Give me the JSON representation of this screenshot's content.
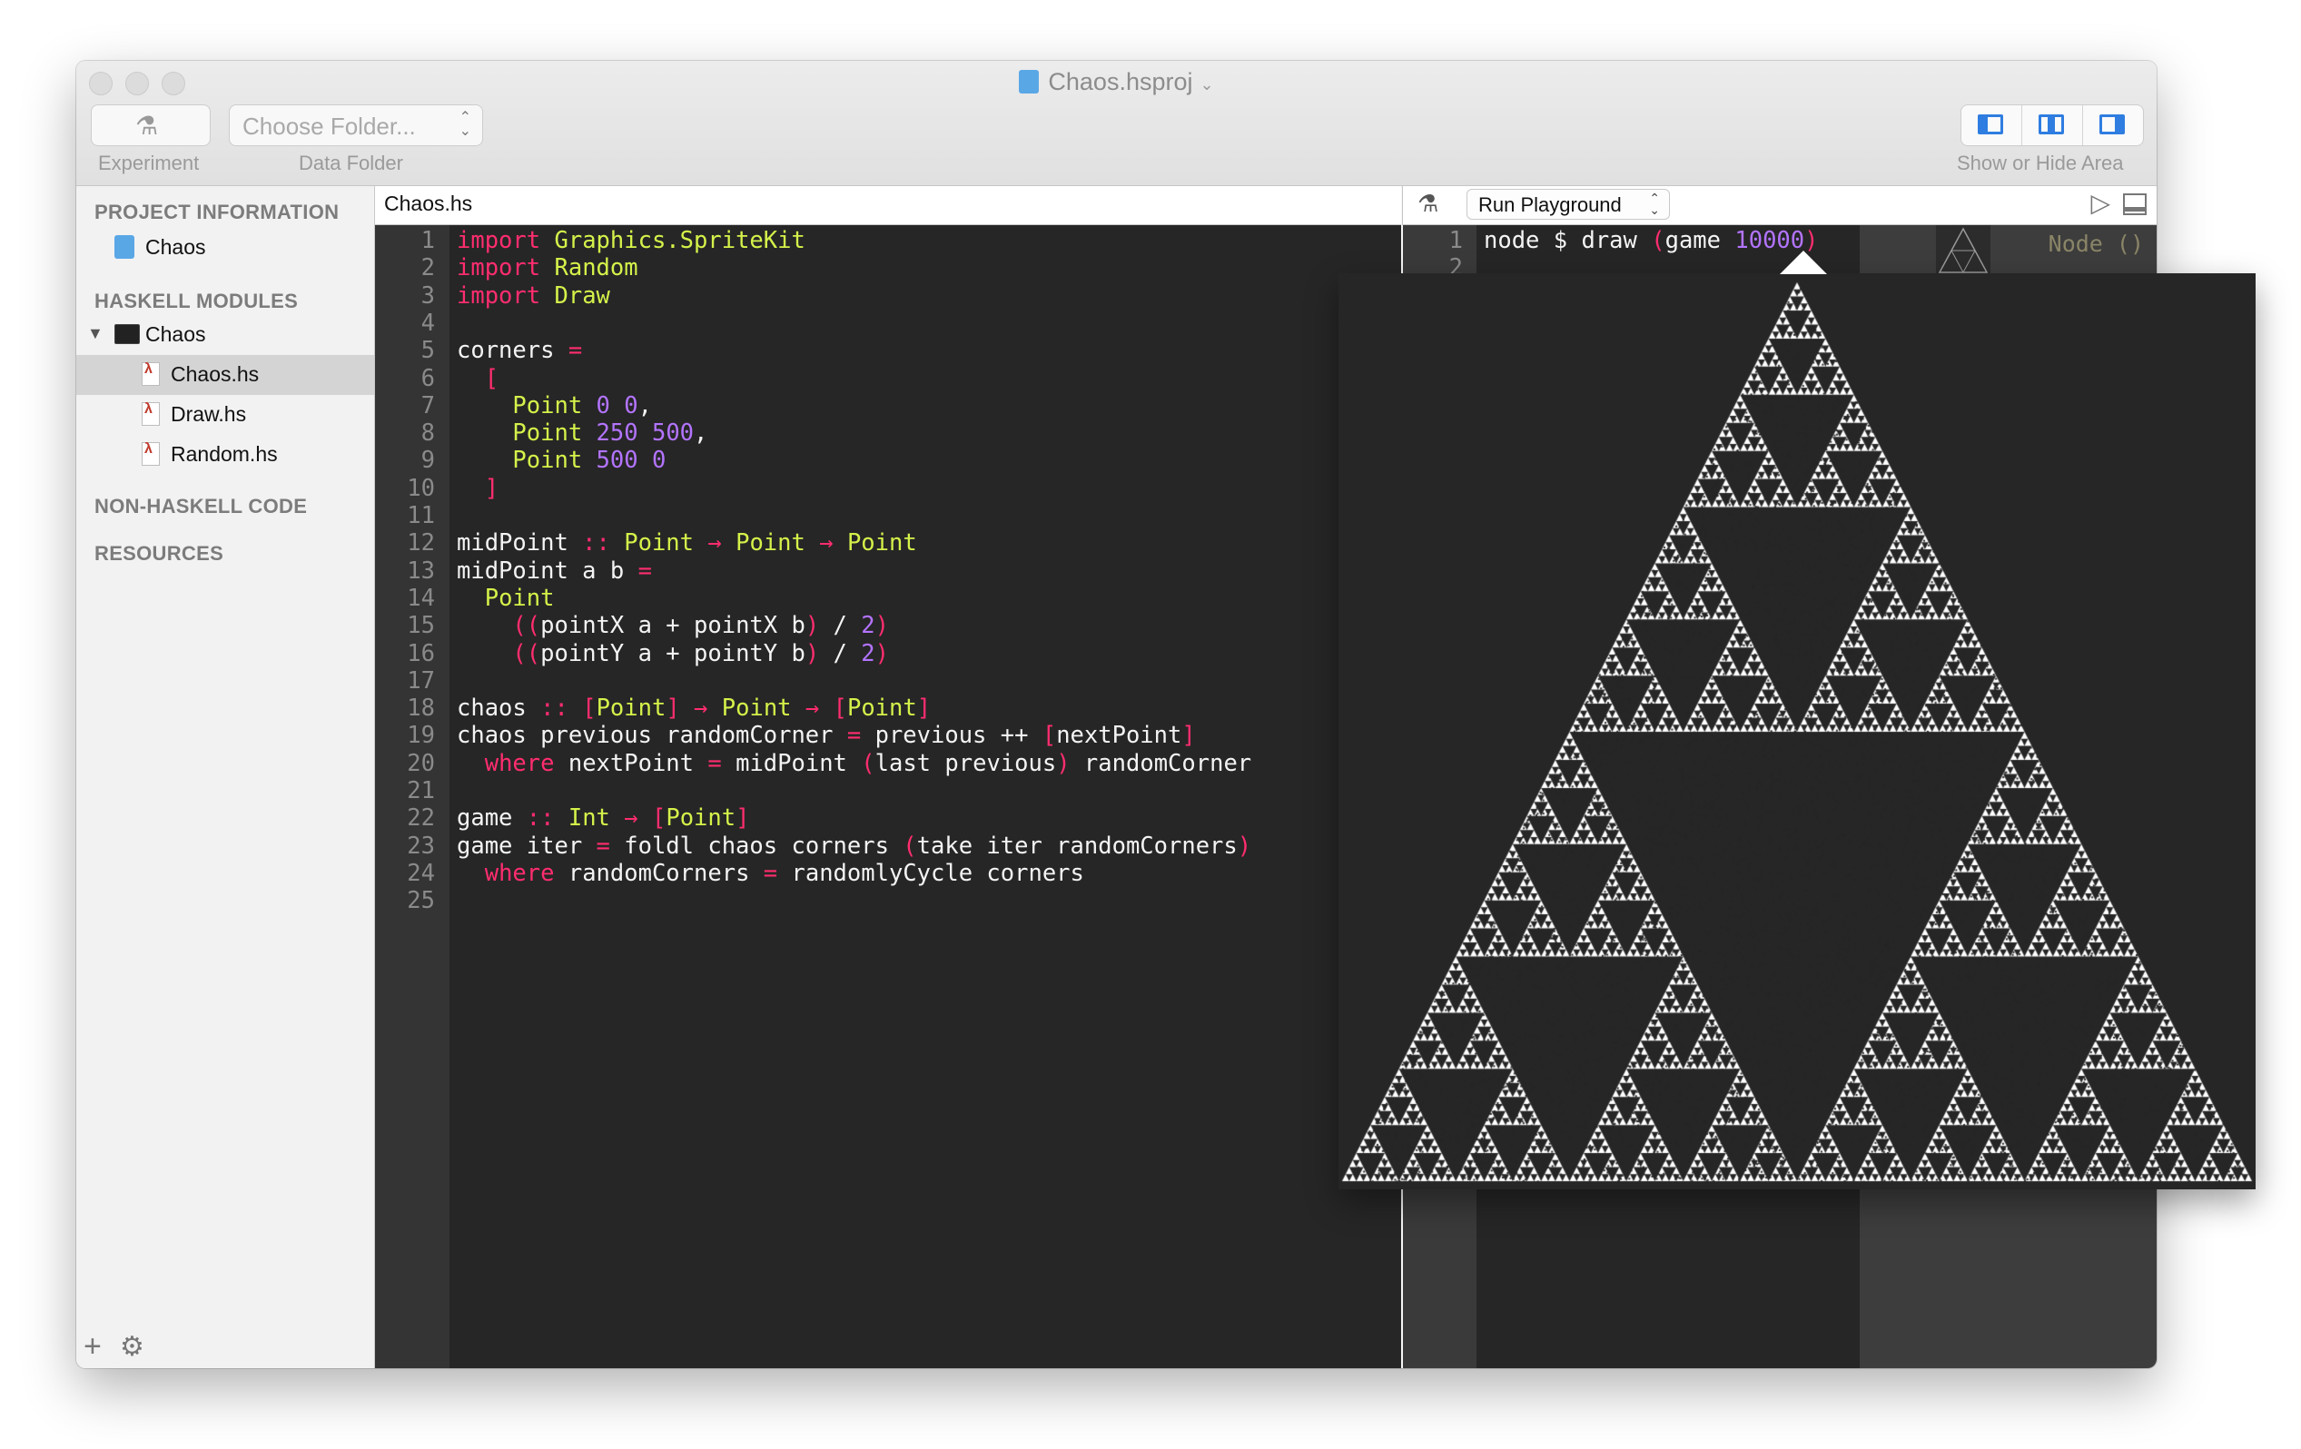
{
  "window": {
    "title": "Chaos.hsproj",
    "title_chevron": "⌄"
  },
  "toolbar": {
    "experiment_label": "Experiment",
    "folder_placeholder": "Choose Folder...",
    "data_folder_label": "Data Folder",
    "show_hide_label": "Show or Hide Area",
    "updown_glyph": "⌃⌄"
  },
  "sidebar": {
    "project_info_header": "PROJECT INFORMATION",
    "project_name": "Chaos",
    "haskell_modules_header": "HASKELL MODULES",
    "module_group": "Chaos",
    "files": [
      "Chaos.hs",
      "Draw.hs",
      "Random.hs"
    ],
    "non_haskell_header": "NON-HASKELL CODE",
    "resources_header": "RESOURCES",
    "add_glyph": "+",
    "gear_glyph": "⚙"
  },
  "editor": {
    "file_name": "Chaos.hs",
    "lines": [
      [
        [
          "k",
          "import"
        ],
        [
          "d",
          " "
        ],
        [
          "t",
          "Graphics.SpriteKit"
        ]
      ],
      [
        [
          "k",
          "import"
        ],
        [
          "d",
          " "
        ],
        [
          "t",
          "Random"
        ]
      ],
      [
        [
          "k",
          "import"
        ],
        [
          "d",
          " "
        ],
        [
          "t",
          "Draw"
        ]
      ],
      [],
      [
        [
          "d",
          "corners "
        ],
        [
          "k",
          "="
        ]
      ],
      [
        [
          "d",
          "  "
        ],
        [
          "p",
          "["
        ]
      ],
      [
        [
          "d",
          "    "
        ],
        [
          "t",
          "Point"
        ],
        [
          "d",
          " "
        ],
        [
          "n",
          "0"
        ],
        [
          "d",
          " "
        ],
        [
          "n",
          "0"
        ],
        [
          "d",
          ","
        ]
      ],
      [
        [
          "d",
          "    "
        ],
        [
          "t",
          "Point"
        ],
        [
          "d",
          " "
        ],
        [
          "n",
          "250"
        ],
        [
          "d",
          " "
        ],
        [
          "n",
          "500"
        ],
        [
          "d",
          ","
        ]
      ],
      [
        [
          "d",
          "    "
        ],
        [
          "t",
          "Point"
        ],
        [
          "d",
          " "
        ],
        [
          "n",
          "500"
        ],
        [
          "d",
          " "
        ],
        [
          "n",
          "0"
        ]
      ],
      [
        [
          "d",
          "  "
        ],
        [
          "p",
          "]"
        ]
      ],
      [],
      [
        [
          "d",
          "midPoint "
        ],
        [
          "k",
          "::"
        ],
        [
          "d",
          " "
        ],
        [
          "t",
          "Point"
        ],
        [
          "d",
          " "
        ],
        [
          "k",
          "→"
        ],
        [
          "d",
          " "
        ],
        [
          "t",
          "Point"
        ],
        [
          "d",
          " "
        ],
        [
          "k",
          "→"
        ],
        [
          "d",
          " "
        ],
        [
          "t",
          "Point"
        ]
      ],
      [
        [
          "d",
          "midPoint a b "
        ],
        [
          "k",
          "="
        ]
      ],
      [
        [
          "d",
          "  "
        ],
        [
          "t",
          "Point"
        ]
      ],
      [
        [
          "d",
          "    "
        ],
        [
          "p",
          "(("
        ],
        [
          "d",
          "pointX a + pointX b"
        ],
        [
          "p",
          ")"
        ],
        [
          "d",
          " / "
        ],
        [
          "n",
          "2"
        ],
        [
          "p",
          ")"
        ]
      ],
      [
        [
          "d",
          "    "
        ],
        [
          "p",
          "(("
        ],
        [
          "d",
          "pointY a + pointY b"
        ],
        [
          "p",
          ")"
        ],
        [
          "d",
          " / "
        ],
        [
          "n",
          "2"
        ],
        [
          "p",
          ")"
        ]
      ],
      [],
      [
        [
          "d",
          "chaos "
        ],
        [
          "k",
          "::"
        ],
        [
          "d",
          " "
        ],
        [
          "p",
          "["
        ],
        [
          "t",
          "Point"
        ],
        [
          "p",
          "]"
        ],
        [
          "d",
          " "
        ],
        [
          "k",
          "→"
        ],
        [
          "d",
          " "
        ],
        [
          "t",
          "Point"
        ],
        [
          "d",
          " "
        ],
        [
          "k",
          "→"
        ],
        [
          "d",
          " "
        ],
        [
          "p",
          "["
        ],
        [
          "t",
          "Point"
        ],
        [
          "p",
          "]"
        ]
      ],
      [
        [
          "d",
          "chaos previous randomCorner "
        ],
        [
          "k",
          "="
        ],
        [
          "d",
          " previous ++ "
        ],
        [
          "p",
          "["
        ],
        [
          "d",
          "nextPoint"
        ],
        [
          "p",
          "]"
        ]
      ],
      [
        [
          "d",
          "  "
        ],
        [
          "k",
          "where"
        ],
        [
          "d",
          " nextPoint "
        ],
        [
          "k",
          "="
        ],
        [
          "d",
          " midPoint "
        ],
        [
          "p",
          "("
        ],
        [
          "d",
          "last previous"
        ],
        [
          "p",
          ")"
        ],
        [
          "d",
          " randomCorner"
        ]
      ],
      [],
      [
        [
          "d",
          "game "
        ],
        [
          "k",
          "::"
        ],
        [
          "d",
          " "
        ],
        [
          "t",
          "Int"
        ],
        [
          "d",
          " "
        ],
        [
          "k",
          "→"
        ],
        [
          "d",
          " "
        ],
        [
          "p",
          "["
        ],
        [
          "t",
          "Point"
        ],
        [
          "p",
          "]"
        ]
      ],
      [
        [
          "d",
          "game iter "
        ],
        [
          "k",
          "="
        ],
        [
          "d",
          " foldl chaos corners "
        ],
        [
          "p",
          "("
        ],
        [
          "d",
          "take iter randomCorners"
        ],
        [
          "p",
          ")"
        ]
      ],
      [
        [
          "d",
          "  "
        ],
        [
          "k",
          "where"
        ],
        [
          "d",
          " randomCorners "
        ],
        [
          "k",
          "="
        ],
        [
          "d",
          " randomlyCycle corners"
        ]
      ],
      []
    ]
  },
  "playground": {
    "run_label": "Run Playground",
    "play_glyph": "▷",
    "lines": [
      [
        [
          "d",
          "node $ draw "
        ],
        [
          "p",
          "("
        ],
        [
          "d",
          "game "
        ],
        [
          "n",
          "10000"
        ],
        [
          "p",
          ")"
        ]
      ],
      []
    ],
    "result_label": "Node ()"
  },
  "fractal": {
    "description_depth": 7,
    "point_color": "#ffffff",
    "background": "#262626"
  }
}
